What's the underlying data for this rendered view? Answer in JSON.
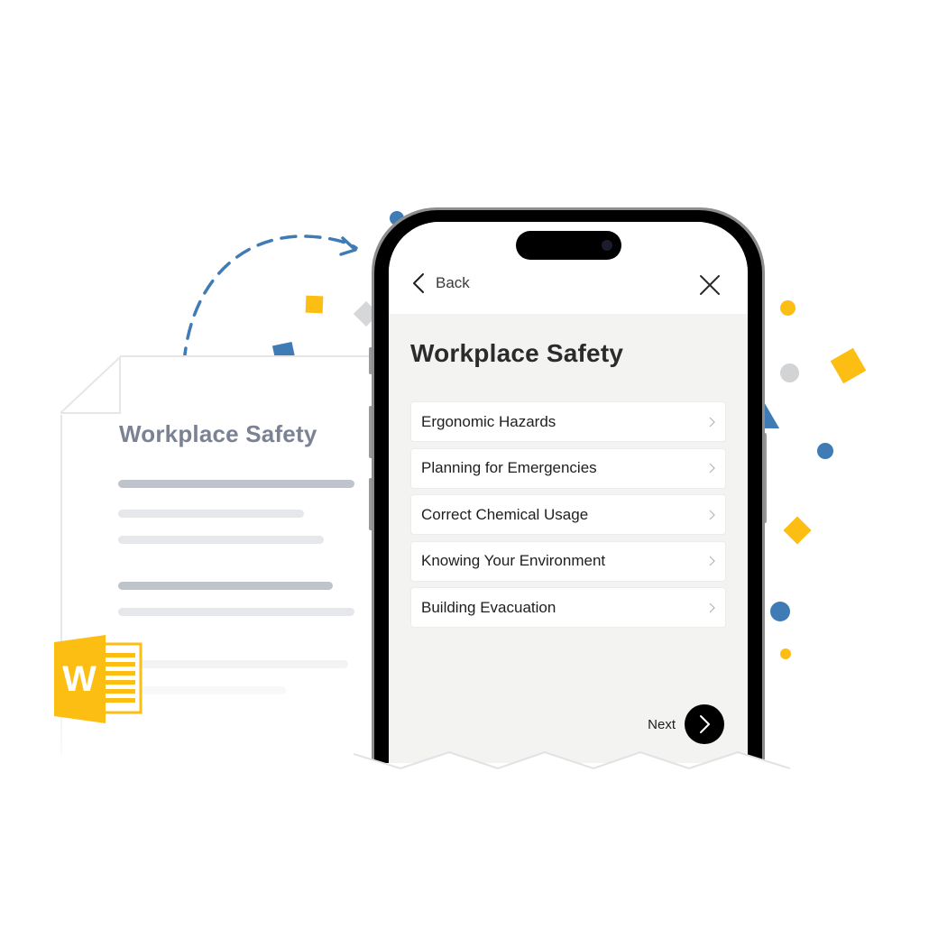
{
  "document": {
    "title": "Workplace Safety",
    "icon": "microsoft-word-icon",
    "icon_letter": "W"
  },
  "phone": {
    "header": {
      "back_label": "Back",
      "back_icon": "chevron-left-icon",
      "close_icon": "close-icon"
    },
    "title": "Workplace Safety",
    "menu_items": [
      {
        "label": "Ergonomic Hazards",
        "icon": "chevron-right-icon"
      },
      {
        "label": "Planning for Emergencies",
        "icon": "chevron-right-icon"
      },
      {
        "label": "Correct Chemical Usage",
        "icon": "chevron-right-icon"
      },
      {
        "label": "Knowing Your Environment",
        "icon": "chevron-right-icon"
      },
      {
        "label": "Building Evacuation",
        "icon": "chevron-right-icon"
      }
    ],
    "next_label": "Next",
    "next_icon": "chevron-right-icon"
  },
  "colors": {
    "accent_blue": "#3f7bb4",
    "accent_yellow": "#fdbe14",
    "neutral_gray": "#d2d3d5",
    "doc_title": "#7a8294",
    "screen_bg": "#f3f3f2"
  }
}
